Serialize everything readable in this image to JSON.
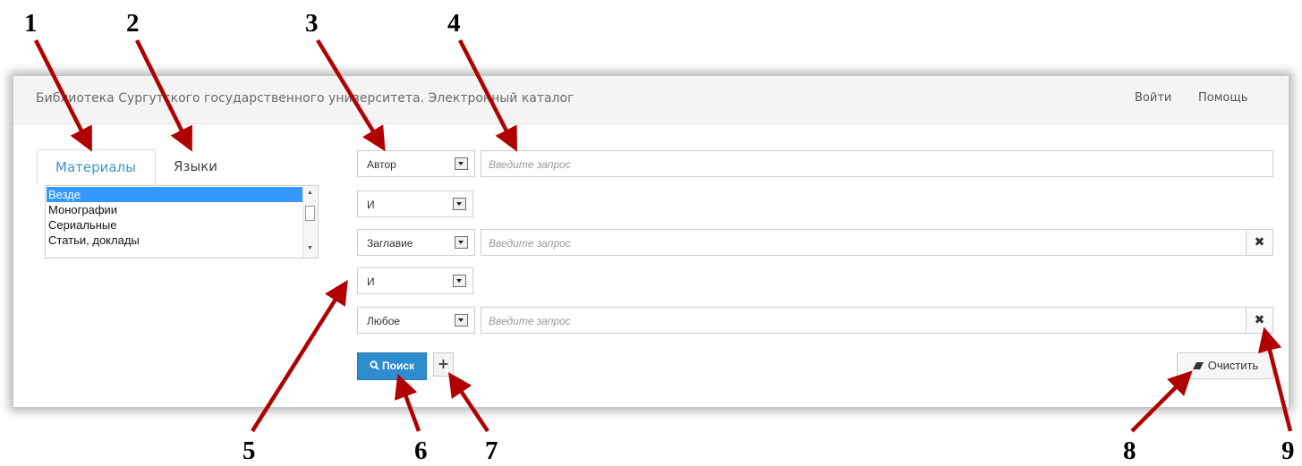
{
  "callouts": [
    "1",
    "2",
    "3",
    "4",
    "5",
    "6",
    "7",
    "8",
    "9"
  ],
  "navbar": {
    "brand": "Библиотека Сургутского государственного университета. Электронный каталог",
    "login": "Войти",
    "help": "Помощь"
  },
  "tabs": [
    {
      "label": "Материалы",
      "active": true
    },
    {
      "label": "Языки",
      "active": false
    }
  ],
  "materials_list": {
    "items": [
      "Везде",
      "Монографии",
      "Сериальные",
      "Статьи, доклады"
    ],
    "selected": "Везде"
  },
  "query_rows": [
    {
      "field": "Автор",
      "placeholder": "Введите запрос",
      "removable": false
    },
    {
      "operator": "И"
    },
    {
      "field": "Заглавие",
      "placeholder": "Введите запрос",
      "removable": true
    },
    {
      "operator": "И"
    },
    {
      "field": "Любое",
      "placeholder": "Введите запрос",
      "removable": true
    }
  ],
  "actions": {
    "search": "Поиск",
    "add": "+",
    "clear": "Очистить",
    "remove": "✖"
  },
  "icons": {
    "search": "magnifier-icon",
    "clear": "eraser-icon",
    "remove": "close-icon",
    "dropdown": "dropdown-arrow-icon"
  },
  "colors": {
    "accent": "#2f8ccf",
    "tab_active_text": "#3a98c9",
    "selection": "#3399ff",
    "annotation_arrow": "#b00000"
  }
}
